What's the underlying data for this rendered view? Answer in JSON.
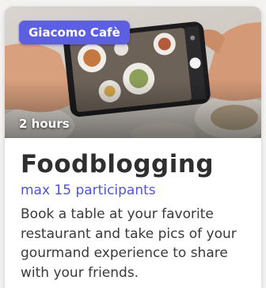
{
  "card": {
    "venue": "Giacomo Cafè",
    "duration": "2 hours",
    "title": "Foodblogging",
    "participants": "max 15 participants",
    "description": "Book a table at your favorite restaurant and take pics of your gourmand experience to share with your friends."
  },
  "colors": {
    "accent": "#5b5fe0",
    "participants_text": "#4f56d6",
    "title_text": "#2f2f2f"
  }
}
